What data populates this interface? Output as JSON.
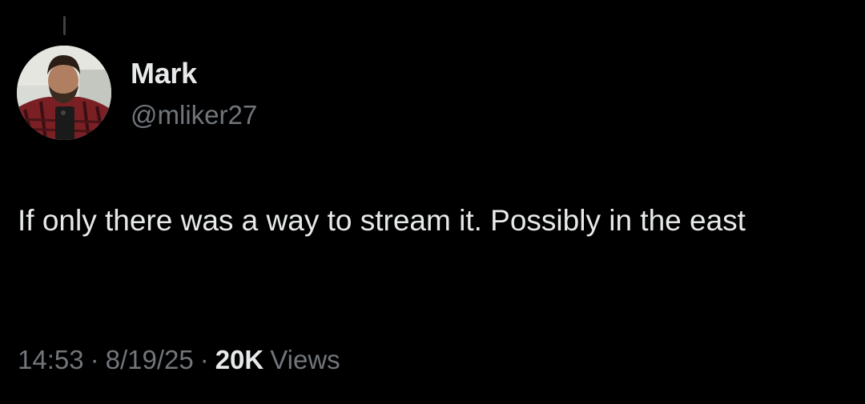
{
  "author": {
    "display_name": "Mark",
    "handle": "@mliker27",
    "avatar": "profile-photo-avatar"
  },
  "tweet": {
    "text": "If only there was a way to stream it. Possibly in the east"
  },
  "meta": {
    "time": "14:53",
    "separator": "·",
    "date": "8/19/25",
    "view_count": "20K",
    "views_label": "Views"
  },
  "colors": {
    "background": "#000000",
    "primary_text": "#e7e9ea",
    "secondary_text": "#71767b"
  }
}
